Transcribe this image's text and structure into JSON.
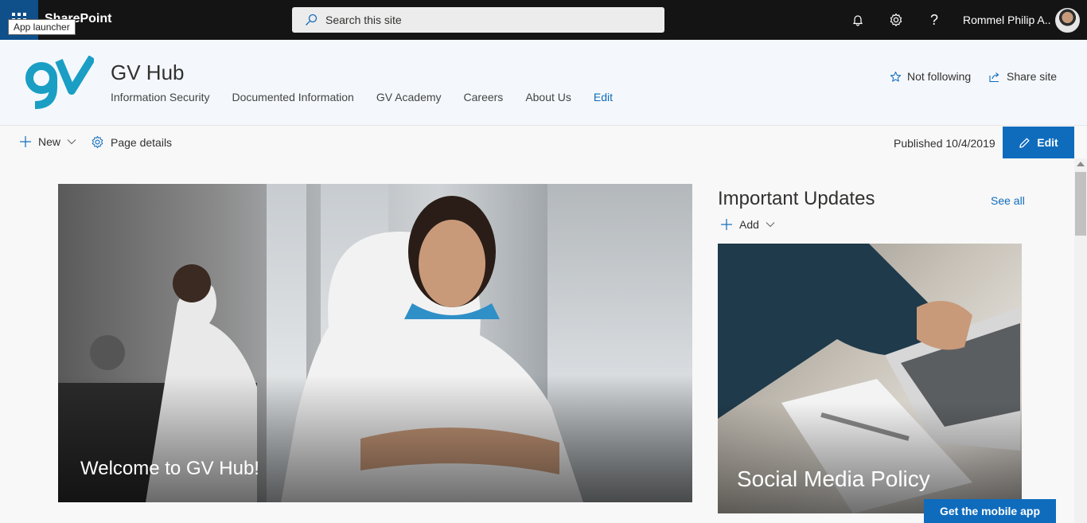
{
  "suite": {
    "app_name": "SharePoint",
    "app_launcher_tooltip": "App launcher",
    "search_placeholder": "Search this site",
    "user_name": "Rommel Philip A..",
    "icons": [
      "waffle-icon",
      "search-icon",
      "bell-icon",
      "gear-icon",
      "help-icon"
    ]
  },
  "site": {
    "title": "GV Hub",
    "nav": [
      "Information Security",
      "Documented Information",
      "GV Academy",
      "Careers",
      "About Us"
    ],
    "nav_edit": "Edit",
    "follow_label": "Not following",
    "share_label": "Share site",
    "logo_color": "#1a9ec4"
  },
  "command_bar": {
    "new_label": "New",
    "page_details_label": "Page details",
    "published": "Published 10/4/2019",
    "edit_label": "Edit"
  },
  "hero": {
    "title": "Welcome to GV Hub!"
  },
  "updates": {
    "title": "Important Updates",
    "see_all": "See all",
    "add_label": "Add",
    "card_title": "Social Media Policy"
  },
  "mobile_app_label": "Get the mobile app",
  "colors": {
    "accent": "#0f6cbd",
    "suitebar": "#141414"
  }
}
